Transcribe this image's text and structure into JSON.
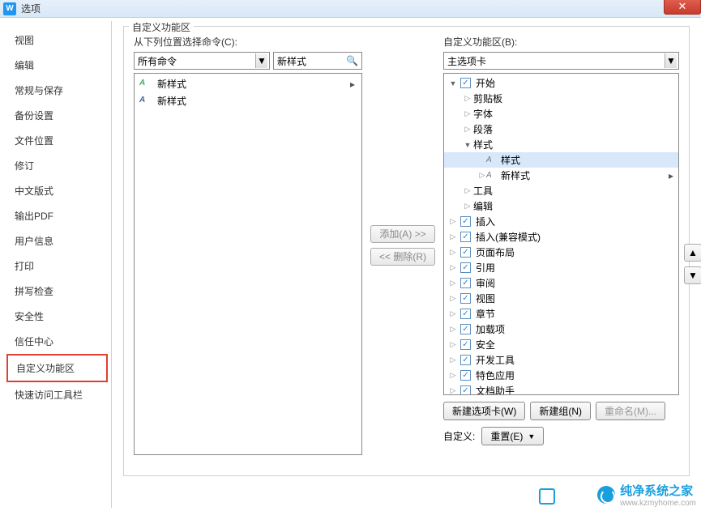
{
  "window": {
    "title": "选项",
    "icon_letter": "W"
  },
  "sidebar": {
    "items": [
      "视图",
      "编辑",
      "常规与保存",
      "备份设置",
      "文件位置",
      "修订",
      "中文版式",
      "输出PDF",
      "用户信息",
      "打印",
      "拼写检查",
      "安全性",
      "信任中心",
      "自定义功能区",
      "快速访问工具栏"
    ],
    "selected_index": 13
  },
  "content": {
    "fieldset_title": "自定义功能区",
    "left": {
      "label": "从下列位置选择命令(C):",
      "combo": "所有命令",
      "search_placeholder": "新样式",
      "list": [
        {
          "icon": "green",
          "text": "新样式",
          "marker": "▸"
        },
        {
          "icon": "blue",
          "text": "新样式"
        }
      ]
    },
    "mid": {
      "add": "添加(A) >>",
      "remove": "<< 删除(R)"
    },
    "right": {
      "label": "自定义功能区(B):",
      "combo": "主选项卡",
      "tree": [
        {
          "d": 0,
          "tri": "open",
          "chk": true,
          "text": "开始"
        },
        {
          "d": 1,
          "tri": "closed",
          "text": "剪贴板"
        },
        {
          "d": 1,
          "tri": "closed",
          "text": "字体"
        },
        {
          "d": 1,
          "tri": "closed",
          "text": "段落"
        },
        {
          "d": 1,
          "tri": "open",
          "text": "样式"
        },
        {
          "d": 2,
          "icon": "g",
          "text": "样式",
          "sel": true
        },
        {
          "d": 2,
          "tri": "closed",
          "icon": "b",
          "text": "新样式",
          "marker": "▸"
        },
        {
          "d": 1,
          "tri": "closed",
          "text": "工具"
        },
        {
          "d": 1,
          "tri": "closed",
          "text": "编辑"
        },
        {
          "d": 0,
          "tri": "closed",
          "chk": true,
          "text": "插入"
        },
        {
          "d": 0,
          "tri": "closed",
          "chk": true,
          "text": "插入(兼容模式)"
        },
        {
          "d": 0,
          "tri": "closed",
          "chk": true,
          "text": "页面布局"
        },
        {
          "d": 0,
          "tri": "closed",
          "chk": true,
          "text": "引用"
        },
        {
          "d": 0,
          "tri": "closed",
          "chk": true,
          "text": "审阅"
        },
        {
          "d": 0,
          "tri": "closed",
          "chk": true,
          "text": "视图"
        },
        {
          "d": 0,
          "tri": "closed",
          "chk": true,
          "text": "章节"
        },
        {
          "d": 0,
          "tri": "closed",
          "chk": true,
          "text": "加载项"
        },
        {
          "d": 0,
          "tri": "closed",
          "chk": true,
          "text": "安全"
        },
        {
          "d": 0,
          "tri": "closed",
          "chk": true,
          "text": "开发工具"
        },
        {
          "d": 0,
          "tri": "closed",
          "chk": true,
          "text": "特色应用"
        },
        {
          "d": 0,
          "tri": "closed",
          "chk": true,
          "text": "文档助手"
        }
      ],
      "buttons": {
        "new_tab": "新建选项卡(W)",
        "new_group": "新建组(N)",
        "rename": "重命名(M)..."
      },
      "custom_label": "自定义:",
      "reset": "重置(E)"
    }
  },
  "watermark": {
    "title": "纯净系统之家",
    "url": "www.kzmyhome.com"
  }
}
